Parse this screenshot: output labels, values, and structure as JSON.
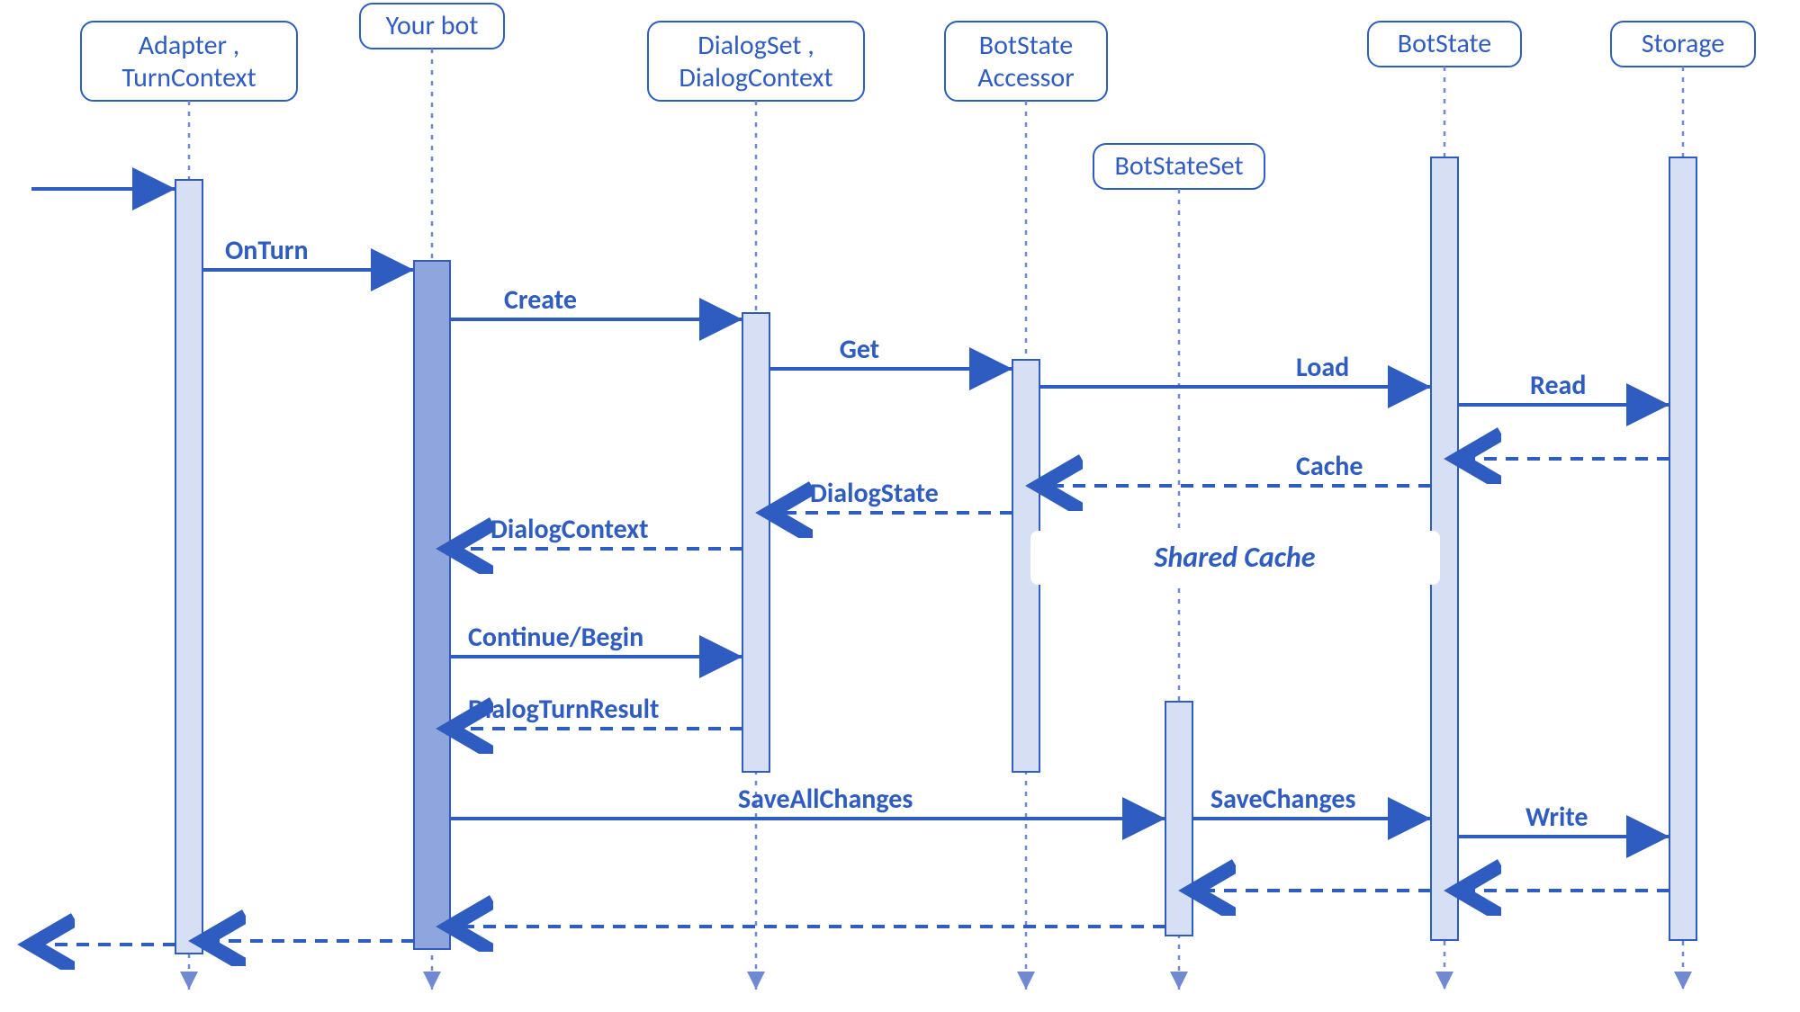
{
  "diagram": {
    "lanes": {
      "adapter": {
        "line1": "Adapter ,",
        "line2": "TurnContext"
      },
      "bot": {
        "line1": "Your bot"
      },
      "dialog": {
        "line1": "DialogSet ,",
        "line2": "DialogContext"
      },
      "accessor": {
        "line1": "BotState",
        "line2": "Accessor"
      },
      "stateset": {
        "line1": "BotStateSet"
      },
      "botstate": {
        "line1": "BotState"
      },
      "storage": {
        "line1": "Storage"
      }
    },
    "messages": {
      "onturn": "OnTurn",
      "create": "Create",
      "get": "Get",
      "load": "Load",
      "read": "Read",
      "cache": "Cache",
      "dialogstate": "DialogState",
      "dialogcontext": "DialogContext",
      "continuebegin": "Continue/Begin",
      "dialogturnresult": "DialogTurnResult",
      "saveallchanges": "SaveAllChanges",
      "savechanges": "SaveChanges",
      "write": "Write"
    },
    "shared_cache": "Shared Cache"
  },
  "chart_data": {
    "type": "sequence-diagram",
    "participants": [
      "Adapter/TurnContext",
      "Your bot",
      "DialogSet/DialogContext",
      "BotState Accessor",
      "BotStateSet",
      "BotState",
      "Storage"
    ],
    "messages": [
      {
        "from": "external",
        "to": "Adapter/TurnContext",
        "label": "",
        "kind": "sync"
      },
      {
        "from": "Adapter/TurnContext",
        "to": "Your bot",
        "label": "OnTurn",
        "kind": "sync"
      },
      {
        "from": "Your bot",
        "to": "DialogSet/DialogContext",
        "label": "Create",
        "kind": "sync"
      },
      {
        "from": "DialogSet/DialogContext",
        "to": "BotState Accessor",
        "label": "Get",
        "kind": "sync"
      },
      {
        "from": "BotState Accessor",
        "to": "BotState",
        "label": "Load",
        "kind": "sync"
      },
      {
        "from": "BotState",
        "to": "Storage",
        "label": "Read",
        "kind": "sync"
      },
      {
        "from": "Storage",
        "to": "BotState",
        "label": "",
        "kind": "return"
      },
      {
        "from": "BotState",
        "to": "BotState Accessor",
        "label": "Cache",
        "kind": "return"
      },
      {
        "from": "BotState Accessor",
        "to": "DialogSet/DialogContext",
        "label": "DialogState",
        "kind": "return"
      },
      {
        "from": "DialogSet/DialogContext",
        "to": "Your bot",
        "label": "DialogContext",
        "kind": "return"
      },
      {
        "from": "Your bot",
        "to": "DialogSet/DialogContext",
        "label": "Continue/Begin",
        "kind": "sync"
      },
      {
        "from": "DialogSet/DialogContext",
        "to": "Your bot",
        "label": "DialogTurnResult",
        "kind": "return"
      },
      {
        "from": "Your bot",
        "to": "BotStateSet",
        "label": "SaveAllChanges",
        "kind": "sync"
      },
      {
        "from": "BotStateSet",
        "to": "BotState",
        "label": "SaveChanges",
        "kind": "sync"
      },
      {
        "from": "BotState",
        "to": "Storage",
        "label": "Write",
        "kind": "sync"
      },
      {
        "from": "Storage",
        "to": "BotState",
        "label": "",
        "kind": "return"
      },
      {
        "from": "BotState",
        "to": "BotStateSet",
        "label": "",
        "kind": "return"
      },
      {
        "from": "BotStateSet",
        "to": "Your bot",
        "label": "",
        "kind": "return"
      },
      {
        "from": "Your bot",
        "to": "Adapter/TurnContext",
        "label": "",
        "kind": "return"
      },
      {
        "from": "Adapter/TurnContext",
        "to": "external",
        "label": "",
        "kind": "return"
      }
    ],
    "annotations": [
      {
        "label": "Shared Cache",
        "spans": [
          "BotState Accessor",
          "BotState"
        ]
      }
    ]
  }
}
